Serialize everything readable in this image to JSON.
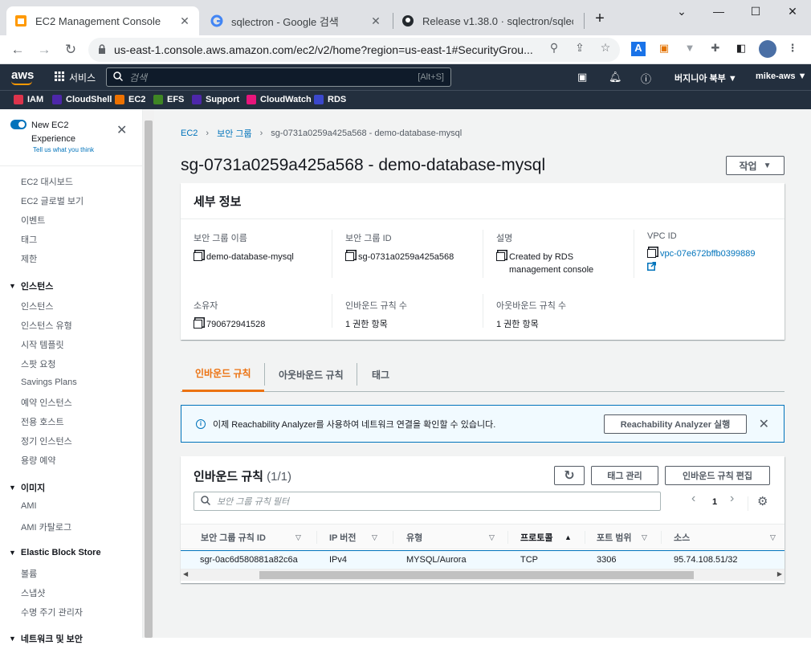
{
  "browser": {
    "tabs": [
      {
        "title": "EC2 Management Console"
      },
      {
        "title": "sqlectron - Google 검색"
      },
      {
        "title": "Release v1.38.0 · sqlectron/sqlec"
      }
    ],
    "url": "us-east-1.console.aws.amazon.com/ec2/v2/home?region=us-east-1#SecurityGrou..."
  },
  "aws_nav": {
    "logo": "aws",
    "services_label": "서비스",
    "search_placeholder": "검색",
    "search_shortcut": "[Alt+S]",
    "region": "버지니아 북부 ▼",
    "user": "mike-aws ▼",
    "favorites": [
      {
        "label": "IAM",
        "color": "#dd344c"
      },
      {
        "label": "CloudShell",
        "color": "#4d27aa"
      },
      {
        "label": "EC2",
        "color": "#ed7100"
      },
      {
        "label": "EFS",
        "color": "#3f8624"
      },
      {
        "label": "Support",
        "color": "#4d27aa"
      },
      {
        "label": "CloudWatch",
        "color": "#e7157b"
      },
      {
        "label": "RDS",
        "color": "#3b48cc"
      }
    ]
  },
  "sidebar": {
    "new_experience_title": "New EC2\nExperience",
    "new_experience_sub": "Tell us what you think",
    "items_top": [
      "EC2 대시보드",
      "EC2 글로벌 보기",
      "이벤트",
      "태그",
      "제한"
    ],
    "section_instances": "인스턴스",
    "instances_items": [
      "인스턴스",
      "인스턴스 유형",
      "시작 템플릿",
      "스팟 요청",
      "Savings Plans",
      "예약 인스턴스",
      "전용 호스트",
      "정기 인스턴스",
      "용량 예약"
    ],
    "section_images": "이미지",
    "images_items": [
      "AMI",
      "AMI 카탈로그"
    ],
    "section_ebs": "Elastic Block Store",
    "ebs_items": [
      "볼륨",
      "스냅샷",
      "수명 주기 관리자"
    ],
    "section_network": "네트워크 및 보안"
  },
  "breadcrumb": {
    "root": "EC2",
    "parent": "보안 그룹",
    "current": "sg-0731a0259a425a568 - demo-database-mysql"
  },
  "page_title": "sg-0731a0259a425a568 - demo-database-mysql",
  "actions_label": "작업",
  "details": {
    "header": "세부 정보",
    "sg_name_label": "보안 그룹 이름",
    "sg_name": "demo-database-mysql",
    "sg_id_label": "보안 그룹 ID",
    "sg_id": "sg-0731a0259a425a568",
    "desc_label": "설명",
    "desc": "Created by RDS management console",
    "vpc_label": "VPC ID",
    "vpc": "vpc-07e672bffb0399889",
    "owner_label": "소유자",
    "owner": "790672941528",
    "inbound_count_label": "인바운드 규칙 수",
    "inbound_count": "1 권한 항목",
    "outbound_count_label": "아웃바운드 규칙 수",
    "outbound_count": "1 권한 항목"
  },
  "tabs": [
    "인바운드 규칙",
    "아웃바운드 규칙",
    "태그"
  ],
  "flash": {
    "message": "이제 Reachability Analyzer를 사용하여 네트워크 연결을 확인할 수 있습니다.",
    "button": "Reachability Analyzer 실행"
  },
  "inbound": {
    "title": "인바운드 규칙",
    "count": "(1/1)",
    "manage_tags": "태그 관리",
    "edit_rules": "인바운드 규칙 편집",
    "filter_placeholder": "보안 그룹 규칙 필터",
    "page": "1",
    "columns": [
      "보안 그룹 규칙 ID",
      "IP 버전",
      "유형",
      "프로토콜",
      "포트 범위",
      "소스"
    ],
    "rows": [
      [
        "sgr-0ac6d580881a82c6a",
        "IPv4",
        "MYSQL/Aurora",
        "TCP",
        "3306",
        "95.74.108.51/32"
      ]
    ]
  }
}
